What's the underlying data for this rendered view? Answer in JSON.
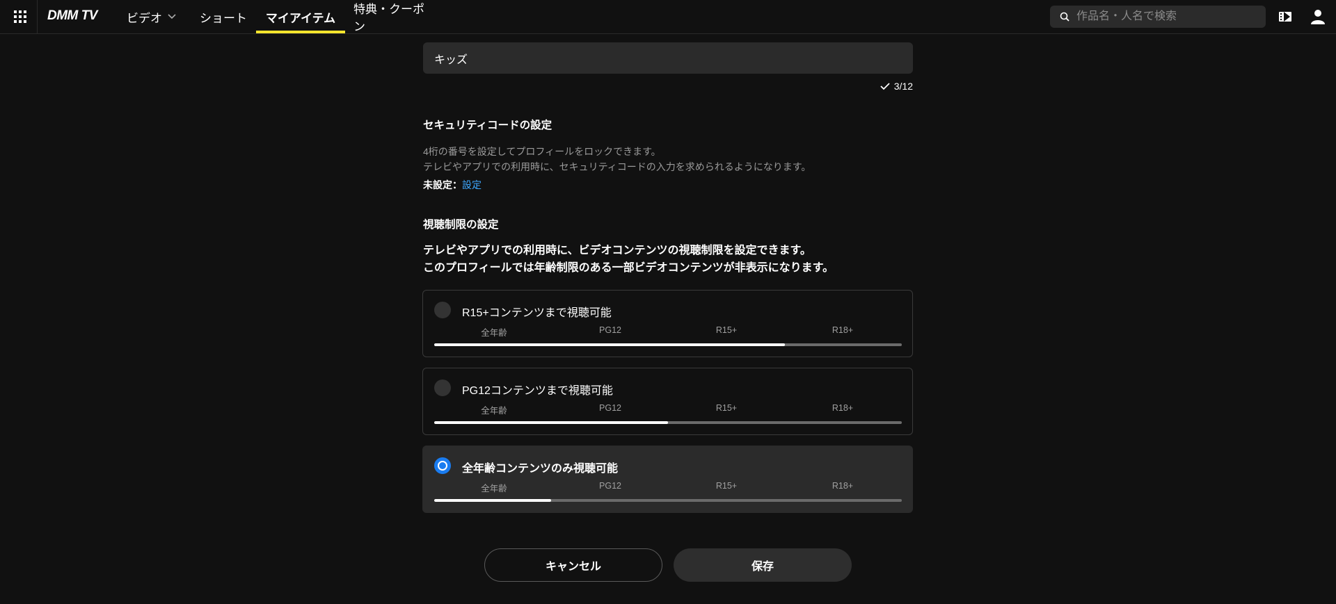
{
  "header": {
    "logo": "DMM TV",
    "nav": [
      {
        "label": "ビデオ"
      },
      {
        "label": "ショート"
      },
      {
        "label": "マイアイテム"
      },
      {
        "label": "特典・クーポン"
      }
    ],
    "search_placeholder": "作品名・人名で検索",
    "accent_color": "#f5e52d"
  },
  "profile": {
    "name_value": "キッズ",
    "char_count": "3/12"
  },
  "security": {
    "title": "セキュリティコードの設定",
    "desc_line1": "4桁の番号を設定してプロフィールをロックできます。",
    "desc_line2": "テレビやアプリでの利用時に、セキュリティコードの入力を求められるようになります。",
    "status_label": "未設定：",
    "status_link": "設定",
    "link_color": "#3ea8ff"
  },
  "restriction": {
    "title": "視聴制限の設定",
    "desc_line1": "テレビやアプリでの利用時に、ビデオコンテンツの視聴制限を設定できます。",
    "desc_line2": "このプロフィールでは年齢制限のある一部ビデオコンテンツが非表示になります。",
    "ticks": [
      "全年齢",
      "PG12",
      "R15+",
      "R18+"
    ],
    "options": [
      {
        "label": "R15+コンテンツまで視聴可能",
        "selected": false,
        "level": 0.75
      },
      {
        "label": "PG12コンテンツまで視聴可能",
        "selected": false,
        "level": 0.5
      },
      {
        "label": "全年齢コンテンツのみ視聴可能",
        "selected": true,
        "level": 0.25
      }
    ],
    "selected_color": "#1a7cf0"
  },
  "actions": {
    "cancel_label": "キャンセル",
    "save_label": "保存"
  }
}
